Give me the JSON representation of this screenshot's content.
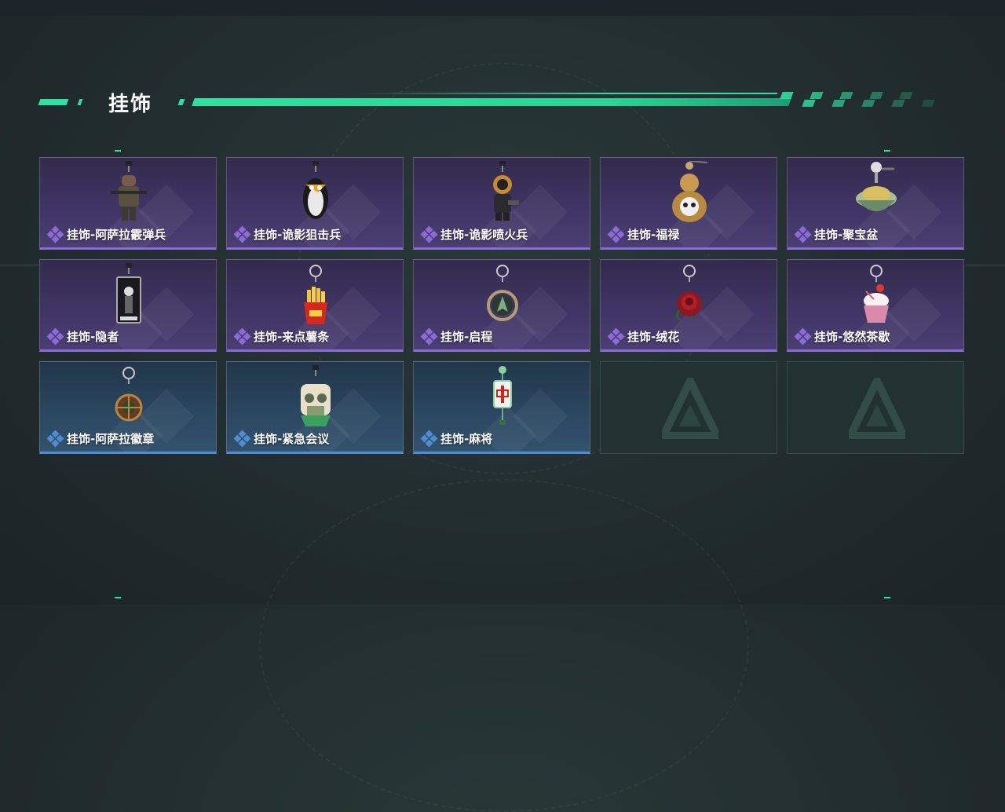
{
  "section": {
    "title": "挂饰"
  },
  "colors": {
    "accent": "#2fe0a0",
    "rarity_purple": "#8c6ad8",
    "rarity_blue": "#4e8ed0"
  },
  "items": [
    {
      "name": "挂饰-阿萨拉霰弹兵",
      "rarity": "purple",
      "icon": "soldier-charm-icon"
    },
    {
      "name": "挂饰-诡影狙击兵",
      "rarity": "purple",
      "icon": "penguin-sniper-charm-icon"
    },
    {
      "name": "挂饰-诡影喷火兵",
      "rarity": "purple",
      "icon": "flamethrower-charm-icon"
    },
    {
      "name": "挂饰-福禄",
      "rarity": "purple",
      "icon": "gourd-charm-icon"
    },
    {
      "name": "挂饰-聚宝盆",
      "rarity": "purple",
      "icon": "treasure-bowl-charm-icon"
    },
    {
      "name": "挂饰-隐者",
      "rarity": "purple",
      "icon": "hermit-card-charm-icon"
    },
    {
      "name": "挂饰-来点薯条",
      "rarity": "purple",
      "icon": "fries-charm-icon"
    },
    {
      "name": "挂饰-启程",
      "rarity": "purple",
      "icon": "compass-ring-charm-icon"
    },
    {
      "name": "挂饰-绒花",
      "rarity": "purple",
      "icon": "rose-charm-icon"
    },
    {
      "name": "挂饰-悠然茶歇",
      "rarity": "purple",
      "icon": "cupcake-charm-icon"
    },
    {
      "name": "挂饰-阿萨拉徽章",
      "rarity": "blue",
      "icon": "badge-charm-icon"
    },
    {
      "name": "挂饰-紧急会议",
      "rarity": "blue",
      "icon": "meeting-charm-icon"
    },
    {
      "name": "挂饰-麻将",
      "rarity": "blue",
      "icon": "mahjong-tile-charm-icon"
    },
    {
      "name": "",
      "rarity": "empty",
      "icon": "empty-slot-logo-icon"
    },
    {
      "name": "",
      "rarity": "empty",
      "icon": "empty-slot-logo-icon"
    }
  ]
}
